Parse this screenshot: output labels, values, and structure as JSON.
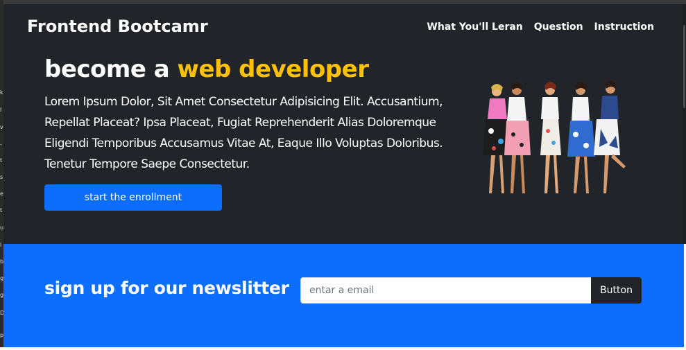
{
  "navbar": {
    "brand": "Frontend Bootcamr",
    "links": [
      "What You'll Leran",
      "Question",
      "Instruction"
    ]
  },
  "hero": {
    "headline_prefix": "become a",
    "headline_accent": "web developer",
    "description": "Lorem Ipsum Dolor, Sit Amet Consectetur Adipisicing Elit. Accusantium, Repellat Placeat? Ipsa Placeat, Fugiat Reprehenderit Alias Doloremque Eligendi Temporibus Accusamus Vitae At, Eaque Illo Voluptas Doloribus. Tenetur Tempore Saepe Consectetur.",
    "cta_label": "start the enrollment",
    "image_icon": "group-of-women-illustration"
  },
  "newsletter": {
    "title": "sign up for our newslitter",
    "input_placeholder": "entar a email",
    "input_value": "",
    "button_label": "Button"
  },
  "colors": {
    "dark_bg": "#212529",
    "primary": "#0d6efd",
    "accent": "#ffc107",
    "text": "#ffffff"
  }
}
